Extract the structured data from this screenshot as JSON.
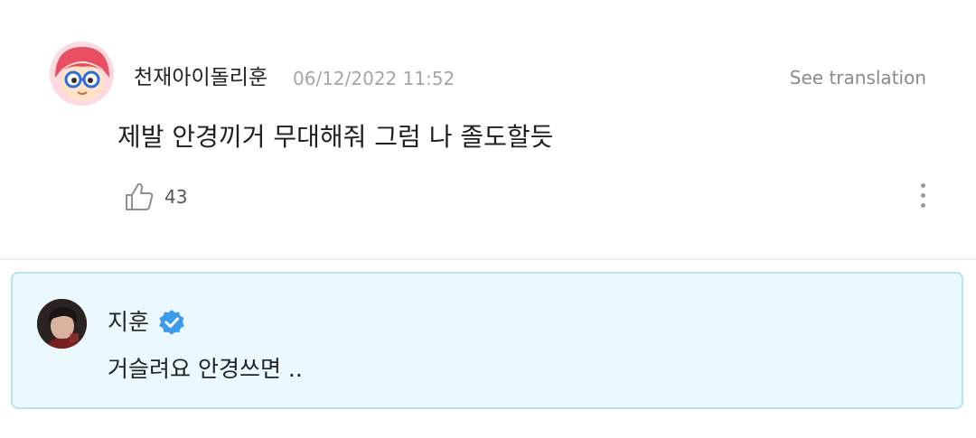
{
  "comment": {
    "username": "천재아이돌리훈",
    "timestamp": "06/12/2022 11:52",
    "translate_label": "See translation",
    "text": "제발 안경끼거 무대해줘 그럼 나 졸도할듯",
    "like_count": "43",
    "like_icon": "thumbs-up-icon",
    "more_icon": "more-vertical-icon"
  },
  "reply": {
    "author": "지훈",
    "verified_icon": "verified-check-icon",
    "text": "거슬려요 안경쓰면 ..",
    "accent_color": "#3d9be9",
    "background_color": "#ebf8fe",
    "border_color": "#b8e3f2"
  }
}
